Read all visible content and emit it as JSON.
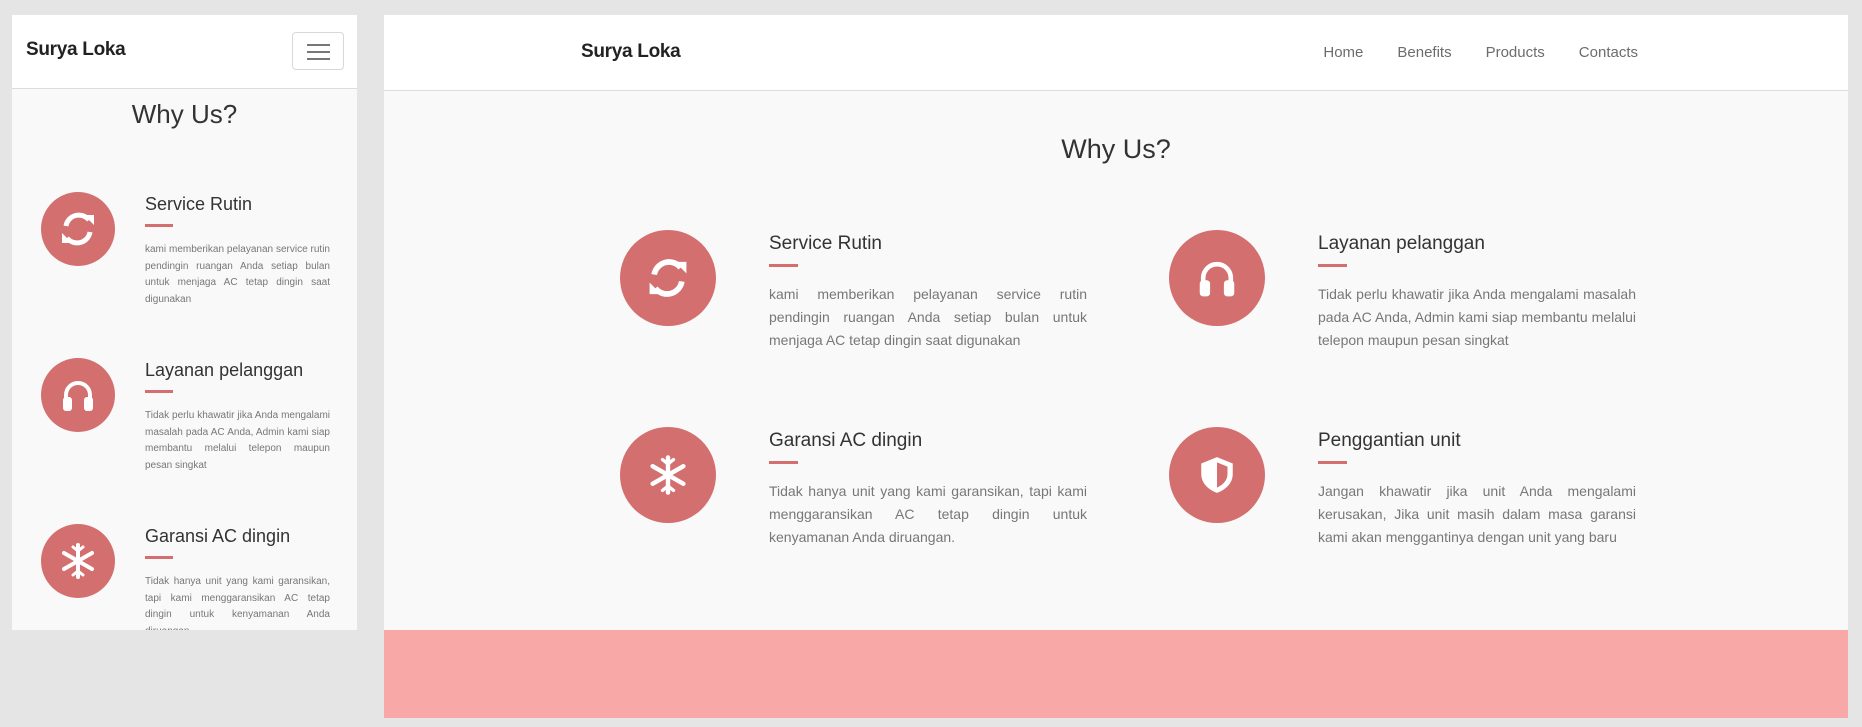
{
  "brand": "Surya Loka",
  "nav": {
    "links": [
      "Home",
      "Benefits",
      "Products",
      "Contacts"
    ]
  },
  "section": {
    "title": "Why Us?"
  },
  "features": [
    {
      "icon": "sync-icon",
      "title": "Service Rutin",
      "desc": "kami memberikan pelayanan service rutin pendingin ruangan Anda setiap bulan untuk menjaga AC tetap dingin saat digunakan"
    },
    {
      "icon": "headphones-icon",
      "title": "Layanan pelanggan",
      "desc": "Tidak perlu khawatir jika Anda mengalami masalah pada AC Anda, Admin kami siap membantu melalui telepon maupun pesan singkat"
    },
    {
      "icon": "snowflake-icon",
      "title": "Garansi AC dingin",
      "desc": "Tidak hanya unit yang kami garansikan, tapi kami menggaransikan AC tetap dingin untuk kenyamanan Anda diruangan."
    },
    {
      "icon": "shield-icon",
      "title": "Penggantian unit",
      "desc": "Jangan khawatir jika unit Anda mengalami kerusakan, Jika unit masih dalam masa garansi kami akan menggantinya dengan unit yang baru"
    }
  ],
  "colors": {
    "accent": "#d46f6f",
    "footer": "#f9a8a8",
    "background": "#f9f9f9"
  }
}
